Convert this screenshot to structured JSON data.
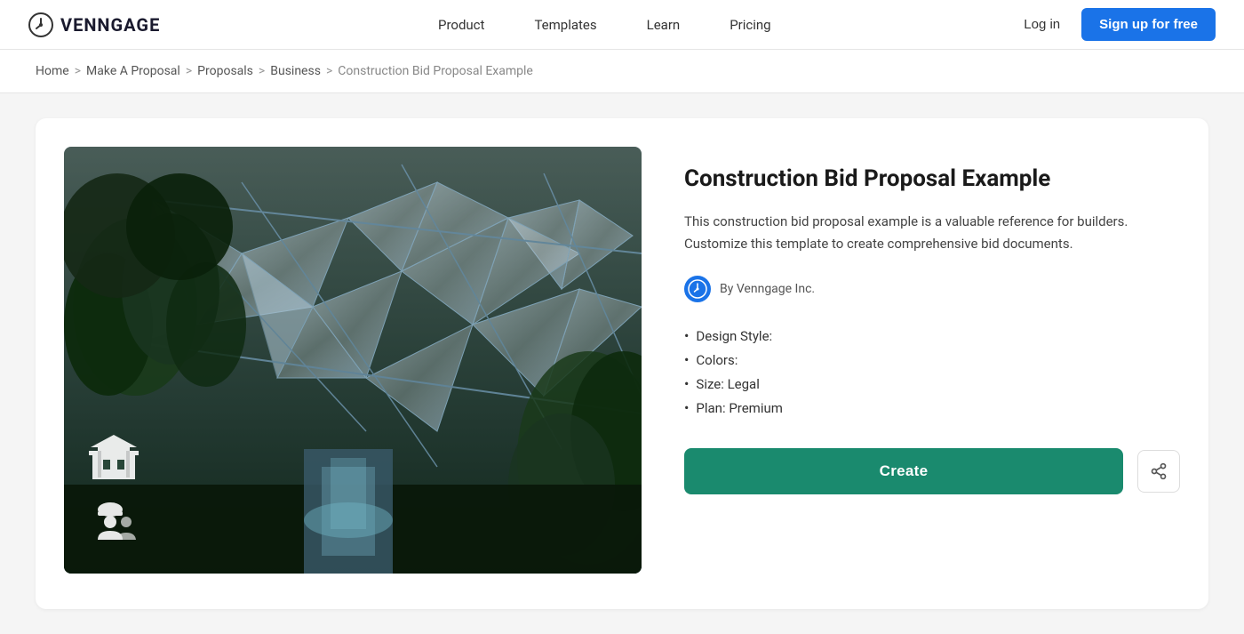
{
  "brand": {
    "name": "VENNGAGE",
    "logo_icon": "clock-circle"
  },
  "nav": {
    "links": [
      {
        "label": "Product",
        "id": "product"
      },
      {
        "label": "Templates",
        "id": "templates"
      },
      {
        "label": "Learn",
        "id": "learn"
      },
      {
        "label": "Pricing",
        "id": "pricing"
      }
    ],
    "login_label": "Log in",
    "signup_label": "Sign up for free"
  },
  "breadcrumb": {
    "items": [
      {
        "label": "Home",
        "id": "home"
      },
      {
        "label": "Make A Proposal",
        "id": "make-a-proposal"
      },
      {
        "label": "Proposals",
        "id": "proposals"
      },
      {
        "label": "Business",
        "id": "business"
      }
    ],
    "current": "Construction Bid Proposal Example"
  },
  "template": {
    "title": "Construction Bid Proposal Example",
    "description": "This construction bid proposal example is a valuable reference for builders. Customize this template to create comprehensive bid documents.",
    "author": "By Venngage Inc.",
    "meta": [
      {
        "label": "Design Style:"
      },
      {
        "label": "Colors:"
      },
      {
        "label": "Size: Legal"
      },
      {
        "label": "Plan: Premium"
      }
    ],
    "create_label": "Create",
    "share_icon": "share"
  },
  "colors": {
    "accent_blue": "#1a73e8",
    "accent_green": "#1a8a6e",
    "nav_bg": "#ffffff"
  }
}
